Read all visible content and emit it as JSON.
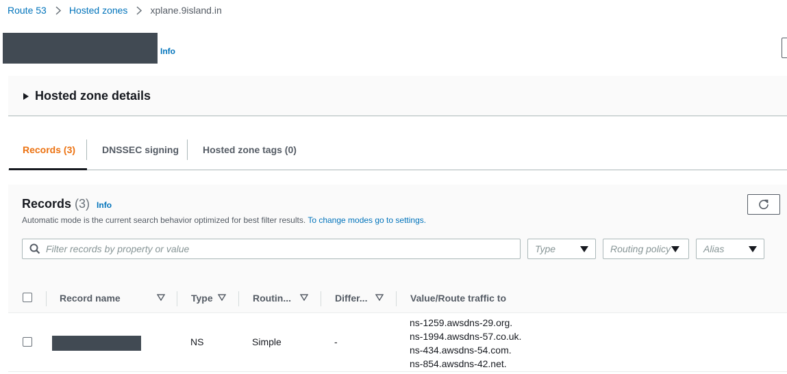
{
  "breadcrumb": {
    "items": [
      "Route 53",
      "Hosted zones"
    ],
    "current": "xplane.9island.in"
  },
  "page": {
    "info_label": "Info"
  },
  "details": {
    "title": "Hosted zone details"
  },
  "tabs": [
    {
      "label": "Records (3)",
      "active": true
    },
    {
      "label": "DNSSEC signing",
      "active": false
    },
    {
      "label": "Hosted zone tags (0)",
      "active": false
    }
  ],
  "records": {
    "title": "Records",
    "count": "(3)",
    "info_label": "Info",
    "description": "Automatic mode is the current search behavior optimized for best filter results.",
    "settings_link": "To change modes go to settings.",
    "search_placeholder": "Filter records by property or value",
    "filters": {
      "type": "Type",
      "routing_policy": "Routing policy",
      "alias": "Alias"
    },
    "columns": [
      "Record name",
      "Type",
      "Routin...",
      "Differ...",
      "Value/Route traffic to"
    ],
    "rows": [
      {
        "type": "NS",
        "routing": "Simple",
        "differ": "-",
        "values": [
          "ns-1259.awsdns-29.org.",
          "ns-1994.awsdns-57.co.uk.",
          "ns-434.awsdns-54.com.",
          "ns-854.awsdns-42.net."
        ]
      }
    ]
  },
  "colors": {
    "link": "#0073bb",
    "active_tab": "#ec7211",
    "text": "#16191f",
    "redacted": "#414a53"
  }
}
